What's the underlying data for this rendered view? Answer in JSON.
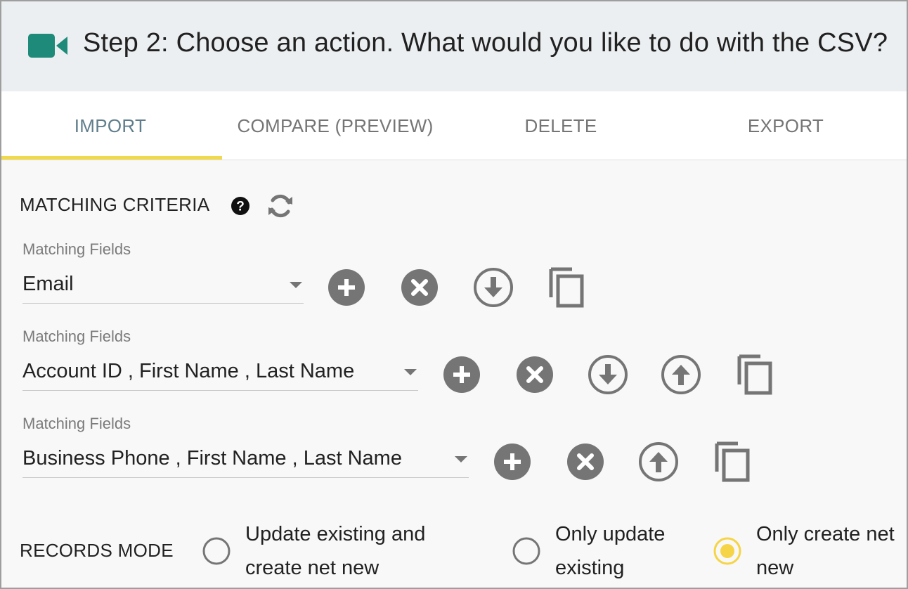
{
  "header": {
    "title": "Step 2: Choose an action. What would you like to do with the CSV?",
    "icon": "video-camera-icon",
    "accent_color": "#1e8a7a"
  },
  "tabs": [
    {
      "label": "IMPORT",
      "active": true
    },
    {
      "label": "COMPARE (PREVIEW)",
      "active": false
    },
    {
      "label": "DELETE",
      "active": false
    },
    {
      "label": "EXPORT",
      "active": false
    }
  ],
  "matching": {
    "title": "MATCHING CRITERIA",
    "rows": [
      {
        "label": "Matching Fields",
        "value": "Email"
      },
      {
        "label": "Matching Fields",
        "value": "Account ID , First Name , Last Name"
      },
      {
        "label": "Matching Fields",
        "value": "Business Phone , First Name , Last Name"
      }
    ]
  },
  "records_mode": {
    "title": "RECORDS MODE",
    "options": [
      {
        "label": "Update existing and create net new",
        "selected": false
      },
      {
        "label": "Only update existing",
        "selected": false
      },
      {
        "label": "Only create net new",
        "selected": true
      }
    ],
    "selected_color": "#f5d547"
  }
}
